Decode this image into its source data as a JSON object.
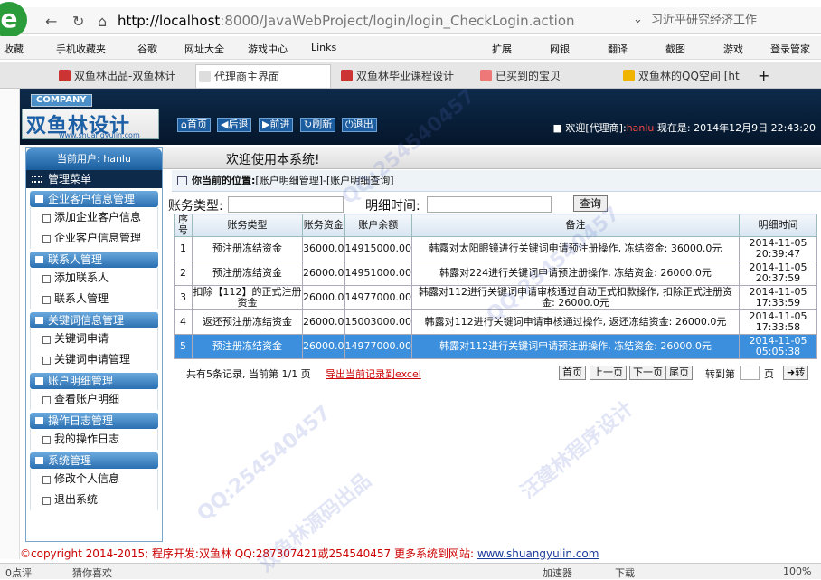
{
  "browser": {
    "logo": "e",
    "url_host": "http://localhost",
    "url_rest": ":8000/JavaWebProject/login/login_CheckLogin.action",
    "search_text": "习近平研究经济工作",
    "bookmarks": [
      "收藏",
      "手机收藏夹",
      "谷歌",
      "网址大全",
      "游戏中心",
      "Links",
      "扩展",
      "网银",
      "翻译",
      "截图",
      "游戏",
      "登录管家"
    ],
    "tabs": [
      "双鱼林出品-双鱼林计",
      "代理商主界面",
      "双鱼林毕业课程设计",
      "已买到的宝贝",
      "双鱼林的QQ空间 [ht"
    ]
  },
  "app": {
    "company": "COMPANY",
    "brand": "双鱼林设计",
    "brand_domain": "www.shuangyulin.com",
    "nav": [
      "首页",
      "后退",
      "前进",
      "刷新",
      "退出"
    ],
    "welcome_prefix": "■ 欢迎[代理商]:",
    "welcome_user": "hanlu",
    "welcome_time": " 现在是: 2014年12月9日 22:43:20"
  },
  "sidebar": {
    "current_user": "当前用户: hanlu",
    "menu_title": "管理菜单",
    "groups": [
      {
        "title": "企业客户信息管理",
        "items": [
          "添加企业客户信息",
          "企业客户信息管理"
        ]
      },
      {
        "title": "联系人管理",
        "items": [
          "添加联系人",
          "联系人管理"
        ]
      },
      {
        "title": "关键词信息管理",
        "items": [
          "关键词申请",
          "关键词申请管理"
        ]
      },
      {
        "title": "账户明细管理",
        "items": [
          "查看账户明细"
        ]
      },
      {
        "title": "操作日志管理",
        "items": [
          "我的操作日志"
        ]
      },
      {
        "title": "系统管理",
        "items": [
          "修改个人信息",
          "退出系统"
        ]
      }
    ]
  },
  "main": {
    "welcome": "欢迎使用本系统!",
    "location_label": "你当前的位置:",
    "location_path": "[账户明细管理]-[账户明细查询]",
    "filter_type_label": "账务类型:",
    "filter_time_label": "明细时间:",
    "query_button": "查询",
    "columns": [
      "序号",
      "账务类型",
      "账务资金",
      "账户余额",
      "备注",
      "明细时间"
    ],
    "rows": [
      [
        "1",
        "预注册冻结资金",
        "36000.0",
        "14915000.00",
        "韩露对太阳眼镜进行关键词申请预注册操作, 冻结资金: 36000.0元",
        "2014-11-05 20:39:47"
      ],
      [
        "2",
        "预注册冻结资金",
        "26000.0",
        "14951000.00",
        "韩露对224进行关键词申请预注册操作, 冻结资金: 26000.0元",
        "2014-11-05 20:37:59"
      ],
      [
        "3",
        "扣除【112】的正式注册资金",
        "26000.0",
        "14977000.00",
        "韩露对112进行关键词申请审核通过自动正式扣款操作, 扣除正式注册资金: 26000.0元",
        "2014-11-05 17:33:59"
      ],
      [
        "4",
        "返还预注册冻结资金",
        "26000.0",
        "15003000.00",
        "韩露对112进行关键词申请审核通过操作, 返还冻结资金: 26000.0元",
        "2014-11-05 17:33:58"
      ],
      [
        "5",
        "预注册冻结资金",
        "26000.0",
        "14977000.00",
        "韩露对112进行关键词申请预注册操作, 冻结资金: 26000.0元",
        "2014-11-05 05:05:38"
      ]
    ],
    "pager_info": "共有5条记录, 当前第 1/1 页",
    "export_link": "导出当前记录到excel",
    "pager_buttons": [
      "首页",
      "上一页",
      "下一页",
      "尾页"
    ],
    "goto_label": "转到第",
    "page_label": "页",
    "goto_button": "➜转"
  },
  "footer": {
    "text": "©copyright 2014-2015; 程序开发:双鱼林  QQ:287307421或254540457  更多系统到网站: ",
    "site": "www.shuangyulin.com"
  },
  "status": {
    "left": "0点评",
    "like": "猜你喜欢",
    "accel": "加速器",
    "download": "下载",
    "zoom": "100%"
  },
  "watermarks": [
    "QQ:254540457",
    "双鱼林源码出品",
    "汪建林程序设计"
  ]
}
